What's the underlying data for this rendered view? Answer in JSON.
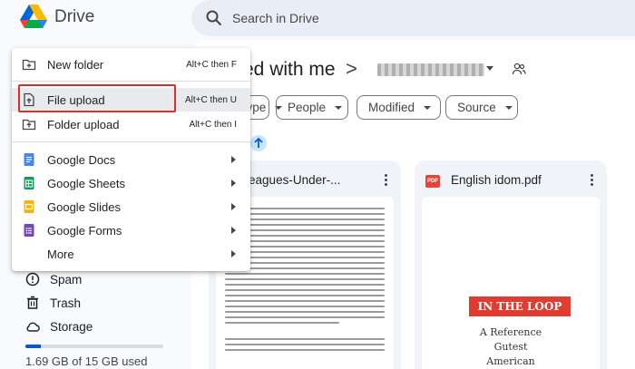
{
  "app": {
    "name": "Drive"
  },
  "search": {
    "placeholder": "Search in Drive"
  },
  "main": {
    "title": "ed with me",
    "breadcrumb_separator": ">",
    "chips": [
      {
        "label": "Type"
      },
      {
        "label": "People"
      },
      {
        "label": "Modified"
      },
      {
        "label": "Source"
      }
    ],
    "files": [
      {
        "name": "0000-Leagues-Under-...",
        "type": "document"
      },
      {
        "name": "English idom.pdf",
        "type": "pdf",
        "badge": "PDF",
        "cover": {
          "banner": "IN THE LOOP",
          "line1": "A Reference",
          "line2": "Gutest",
          "line3": "American"
        }
      }
    ]
  },
  "menu": {
    "items": [
      {
        "label": "New folder",
        "shortcut": "Alt+C then F",
        "icon": "new-folder-icon"
      },
      {
        "label": "File upload",
        "shortcut": "Alt+C then U",
        "icon": "file-upload-icon"
      },
      {
        "label": "Folder upload",
        "shortcut": "Alt+C then I",
        "icon": "folder-upload-icon"
      },
      {
        "label": "Google Docs",
        "icon": "google-docs-icon",
        "color": "#4285f4"
      },
      {
        "label": "Google Sheets",
        "icon": "google-sheets-icon",
        "color": "#0f9d58"
      },
      {
        "label": "Google Slides",
        "icon": "google-slides-icon",
        "color": "#f4b400"
      },
      {
        "label": "Google Forms",
        "icon": "google-forms-icon",
        "color": "#7248b9"
      },
      {
        "label": "More"
      }
    ]
  },
  "sidebar": {
    "items": [
      {
        "label": "Spam",
        "icon": "spam-icon"
      },
      {
        "label": "Trash",
        "icon": "trash-icon"
      },
      {
        "label": "Storage",
        "icon": "cloud-icon"
      }
    ],
    "storage": {
      "text": "1.69 GB of 15 GB used",
      "used_fraction": 0.11
    }
  },
  "colors": {
    "accent": "#0b57d0",
    "highlight_box": "#d93025",
    "background": "#f8fafd",
    "search_bg": "#e9eef6"
  }
}
